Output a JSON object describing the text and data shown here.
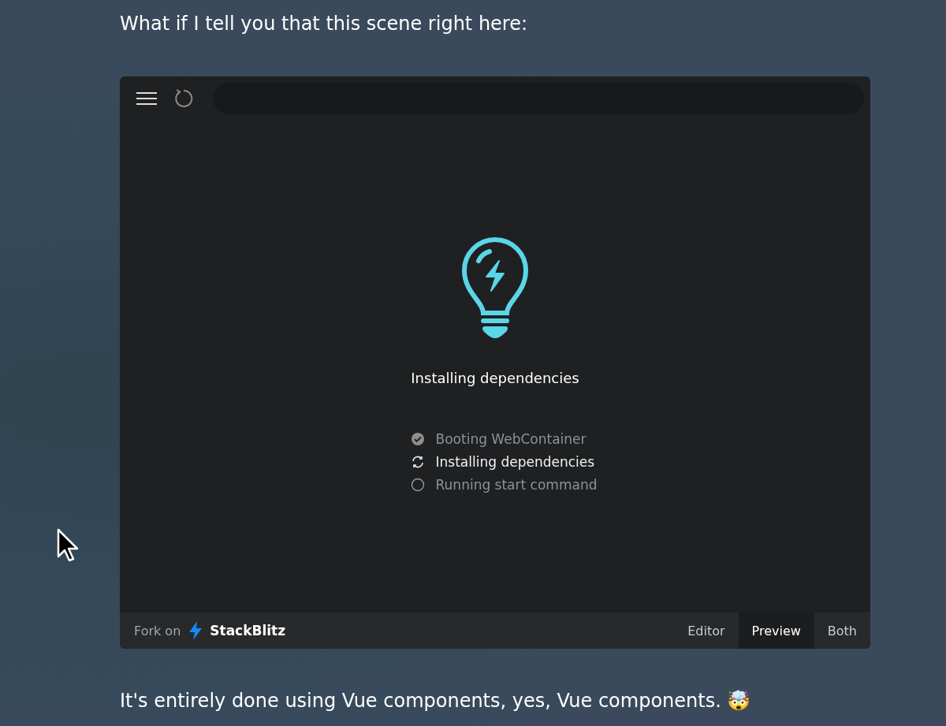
{
  "intro": "What if I tell you that this scene right here:",
  "embed": {
    "loading_title": "Installing dependencies",
    "steps": [
      {
        "label": "Booting WebContainer",
        "kind": "done"
      },
      {
        "label": "Installing dependencies",
        "kind": "active"
      },
      {
        "label": "Running start command",
        "kind": "pending"
      }
    ],
    "footer": {
      "fork_label": "Fork on",
      "brand": "StackBlitz",
      "tabs": [
        {
          "label": "Editor",
          "selected": false
        },
        {
          "label": "Preview",
          "selected": true
        },
        {
          "label": "Both",
          "selected": false
        }
      ]
    }
  },
  "outro": "It's entirely done using Vue components, yes, Vue components. 🤯"
}
